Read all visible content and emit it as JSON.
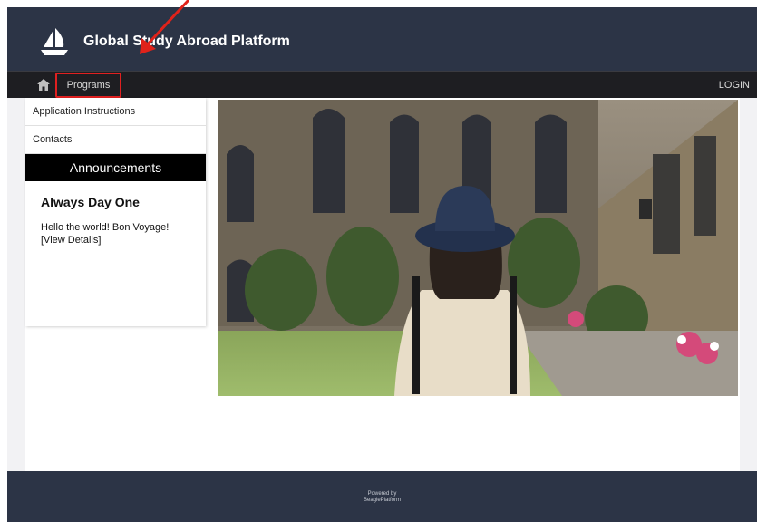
{
  "header": {
    "brand": "Global Study Abroad Platform",
    "bg_color": "#2c3446"
  },
  "nav": {
    "home_icon": "home-icon",
    "programs_label": "Programs",
    "login_label": "LOGIN",
    "highlight_color": "#e02020"
  },
  "sidebar": {
    "items": [
      {
        "label": "Application Instructions"
      },
      {
        "label": "Contacts"
      }
    ],
    "announcements_header": "Announcements",
    "announcement": {
      "title": "Always Day One",
      "body": "Hello the world! Bon Voyage!",
      "link": "[View Details]"
    }
  },
  "footer": {
    "line1": "Powered by",
    "line2": "BeaglePlatform"
  }
}
